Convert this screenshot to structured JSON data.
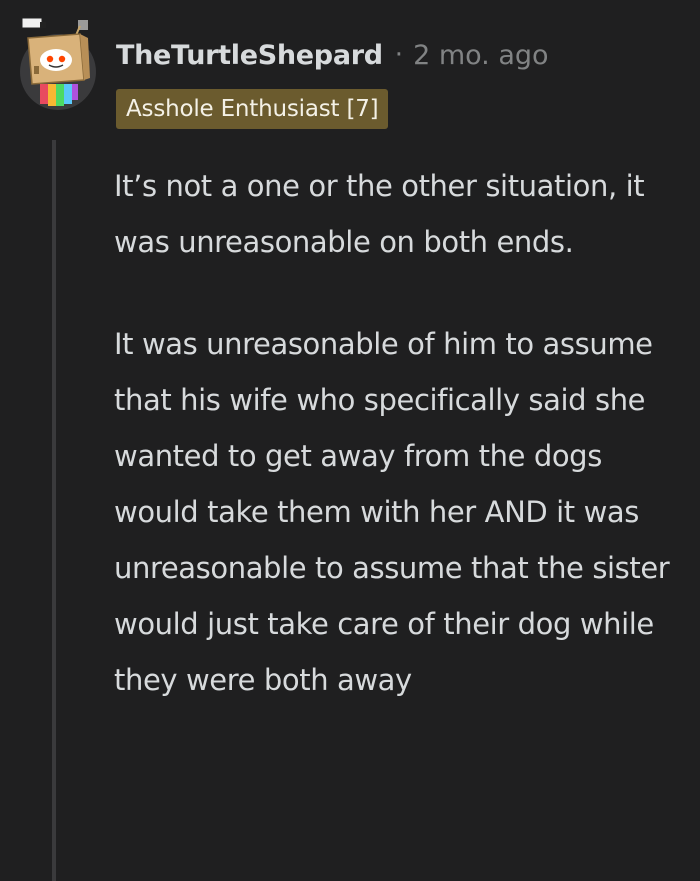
{
  "comment": {
    "author": {
      "username": "TheTurtleShepard",
      "separator": "·",
      "timestamp": "2 mo. ago",
      "avatar_icon": "snoo-box-costume-icon"
    },
    "flair": {
      "text": "Asshole Enthusiast [7]",
      "color": "#6b5b2e"
    },
    "body": {
      "paragraphs": [
        "It’s not a one or the other situation, it was unreasonable on both ends.",
        "It was unreasonable of him to assume that his wife who specifically said she wanted to get away from the dogs would take them with her AND it was unreasonable to assume that the sister would just take care of their dog while they were both away"
      ]
    }
  },
  "theme": {
    "background": "#1f1f20",
    "text": "#d7dadc",
    "muted": "#818384",
    "thread_line": "#3a3a3c"
  }
}
